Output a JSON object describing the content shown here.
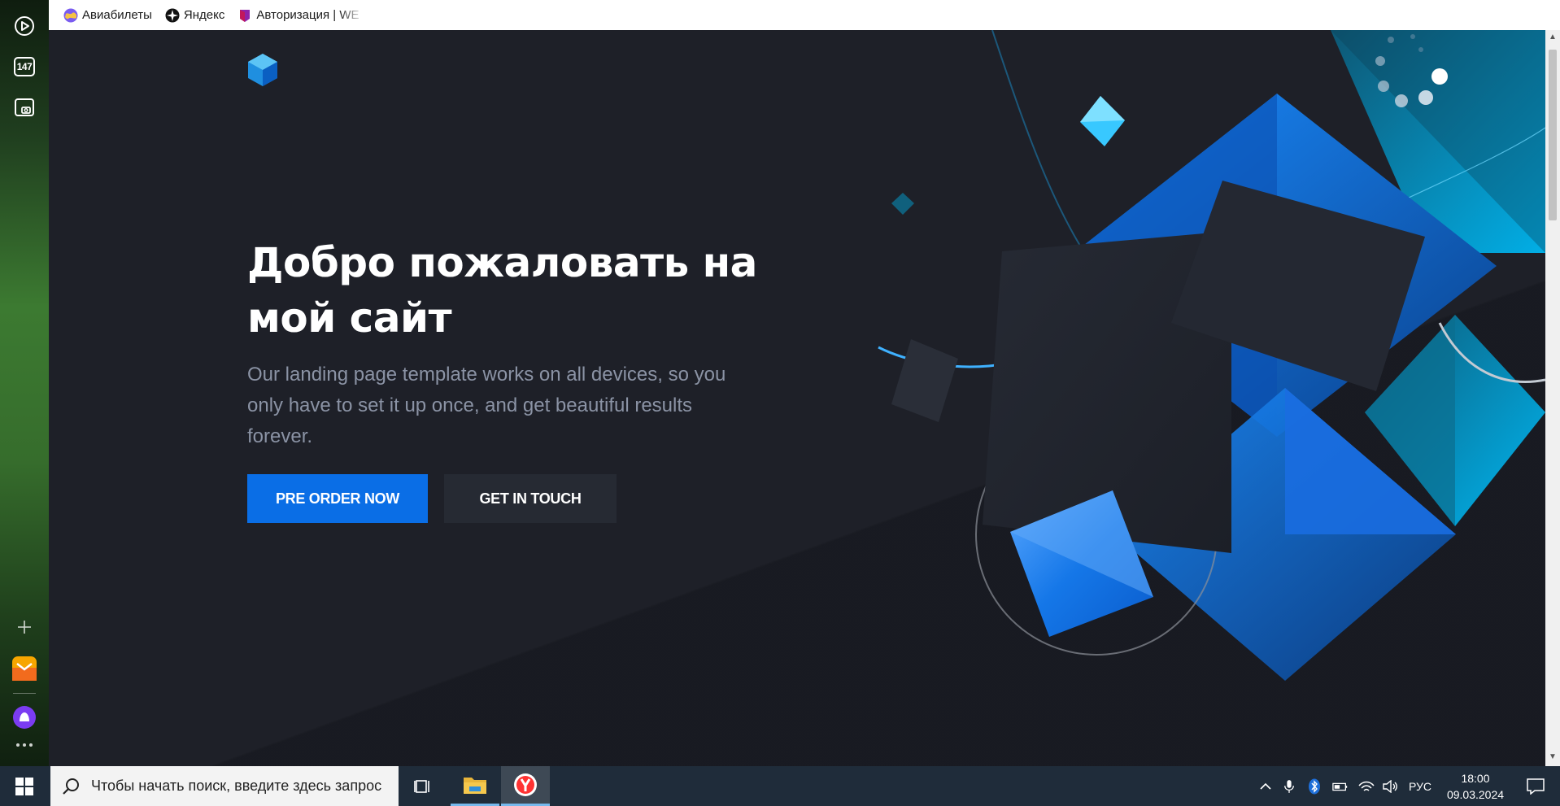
{
  "browser": {
    "bookmarks": [
      {
        "label": "Авиабилеты",
        "icon": "globe-icon"
      },
      {
        "label": "Яндекс",
        "icon": "yandex-icon"
      },
      {
        "label": "Авторизация | WE",
        "icon": "auth-icon"
      }
    ],
    "sidebar": {
      "badge_count": "147"
    }
  },
  "hero": {
    "title_line1": "Добро пожаловать на",
    "title_line2": "мой сайт",
    "description": "Our landing page template works on all devices, so you only have to set it up once, and get beautiful results forever.",
    "primary_button": "PRE ORDER NOW",
    "secondary_button": "GET IN TOUCH"
  },
  "taskbar": {
    "search_placeholder": "Чтобы начать поиск, введите здесь запрос",
    "language": "РУС",
    "time": "18:00",
    "date": "09.03.2024"
  },
  "colors": {
    "page_bg": "#1e2028",
    "accent_blue": "#0a6ee6",
    "text_muted": "#8b93a5",
    "button_dark": "#262a33"
  }
}
